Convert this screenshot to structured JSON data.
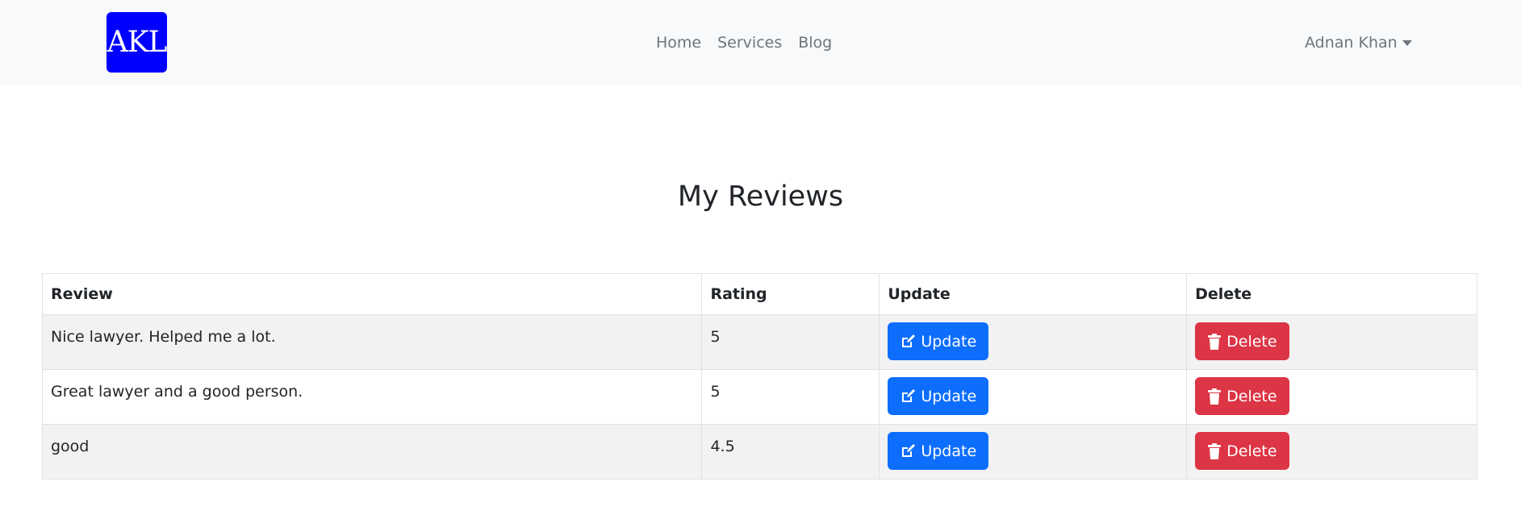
{
  "brand": {
    "logo_text": "AKL",
    "accent_color": "#0000ff"
  },
  "nav": {
    "links": [
      {
        "label": "Home"
      },
      {
        "label": "Services"
      },
      {
        "label": "Blog"
      }
    ],
    "user_name": "Adnan Khan",
    "user_icon": "caret-down-icon"
  },
  "main": {
    "title": "My Reviews",
    "table": {
      "headers": [
        "Review",
        "Rating",
        "Update",
        "Delete"
      ],
      "rows": [
        {
          "review": "Nice lawyer. Helped me a lot.",
          "rating": "5",
          "update_label": "Update",
          "delete_label": "Delete"
        },
        {
          "review": "Great lawyer and a good person.",
          "rating": "5",
          "update_label": "Update",
          "delete_label": "Delete"
        },
        {
          "review": "good",
          "rating": "4.5",
          "update_label": "Update",
          "delete_label": "Delete"
        }
      ]
    }
  },
  "colors": {
    "update_button": "#0d6efd",
    "delete_button": "#dc3545",
    "navbar_bg": "#f8f9fa"
  },
  "icons": {
    "update": "edit-icon",
    "delete": "trash-icon"
  }
}
